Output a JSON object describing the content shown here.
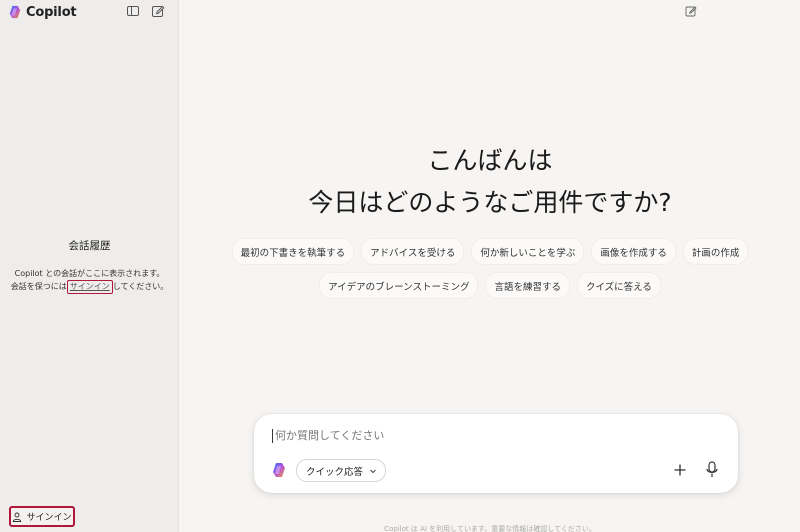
{
  "brand": {
    "name": "Copilot"
  },
  "sidebar": {
    "history_title": "会話履歴",
    "history_desc_line1": "Copilot との会話がここに表示されます。",
    "history_desc_prefix": "会話を保つには",
    "history_link": "サインイン",
    "history_desc_suffix": "してください。",
    "signin_label": "サインイン"
  },
  "greeting": {
    "line1": "こんばんは",
    "line2": "今日はどのようなご用件ですか?"
  },
  "suggestions": {
    "row1": [
      "最初の下書きを執筆する",
      "アドバイスを受ける",
      "何か新しいことを学ぶ",
      "画像を作成する",
      "計画の作成"
    ],
    "row2": [
      "アイデアのブレーンストーミング",
      "言語を練習する",
      "クイズに答える"
    ]
  },
  "composer": {
    "placeholder": "何か質問してください",
    "mode_label": "クイック応答"
  },
  "footer": {
    "text": "Copilot は AI を利用しています。重要な情報は確認してください。"
  },
  "colors": {
    "sidebar_bg": "#efedeb",
    "main_bg": "#f7f5f3",
    "highlight": "#b0173a"
  }
}
